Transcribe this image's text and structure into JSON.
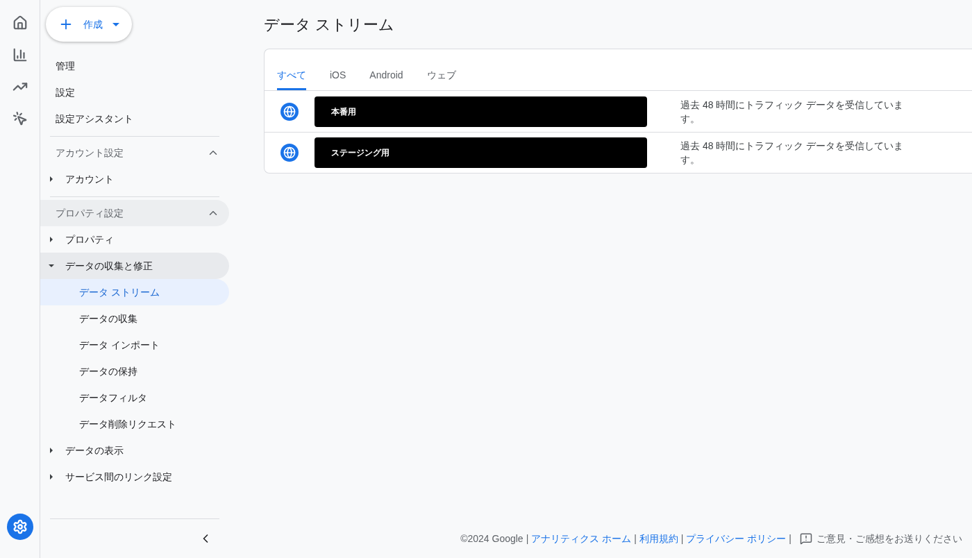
{
  "rail": {
    "items": [
      {
        "kind": "home",
        "selected": false
      },
      {
        "kind": "reports",
        "selected": false
      },
      {
        "kind": "explore",
        "selected": false
      },
      {
        "kind": "advertising",
        "selected": false
      }
    ],
    "settings": {
      "selected": true
    }
  },
  "sidebar": {
    "create_button": {
      "label": "作成"
    },
    "top_items": [
      "管理",
      "設定",
      "設定アシスタント"
    ],
    "sections": [
      {
        "title": "アカウント設定",
        "expanded": true,
        "highlighted": false,
        "items": [
          {
            "label": "アカウント",
            "expanded": false,
            "highlighted": false
          }
        ]
      },
      {
        "title": "プロパティ設定",
        "expanded": true,
        "highlighted": true,
        "items": [
          {
            "label": "プロパティ",
            "expanded": false,
            "highlighted": false
          },
          {
            "label": "データの収集と修正",
            "expanded": true,
            "highlighted": true,
            "children": [
              {
                "label": "データ ストリーム",
                "selected": true
              },
              {
                "label": "データの収集",
                "selected": false
              },
              {
                "label": "データ インポート",
                "selected": false
              },
              {
                "label": "データの保持",
                "selected": false
              },
              {
                "label": "データフィルタ",
                "selected": false
              },
              {
                "label": "データ削除リクエスト",
                "selected": false
              }
            ]
          },
          {
            "label": "データの表示",
            "expanded": false,
            "highlighted": false
          },
          {
            "label": "サービス間のリンク設定",
            "expanded": false,
            "highlighted": false
          }
        ]
      }
    ]
  },
  "main": {
    "title": "データ ストリーム",
    "tabs": [
      {
        "label": "すべて",
        "selected": true
      },
      {
        "label": "iOS",
        "selected": false
      },
      {
        "label": "Android",
        "selected": false
      },
      {
        "label": "ウェブ",
        "selected": false
      }
    ],
    "streams": [
      {
        "name": "本番用",
        "status": "過去 48 時間にトラフィック データを受信しています。"
      },
      {
        "name": "ステージング用",
        "status": "過去 48 時間にトラフィック データを受信しています。"
      }
    ]
  },
  "footer": {
    "copyright": "©2024 Google",
    "links": [
      {
        "separator": "|",
        "label": "アナリティクス ホーム"
      },
      {
        "separator": "|",
        "label": "利用規約"
      },
      {
        "separator": "|",
        "label": "プライバシー ポリシー"
      }
    ],
    "feedback_separator": "|",
    "feedback": "ご意見・ご感想をお送りください"
  }
}
